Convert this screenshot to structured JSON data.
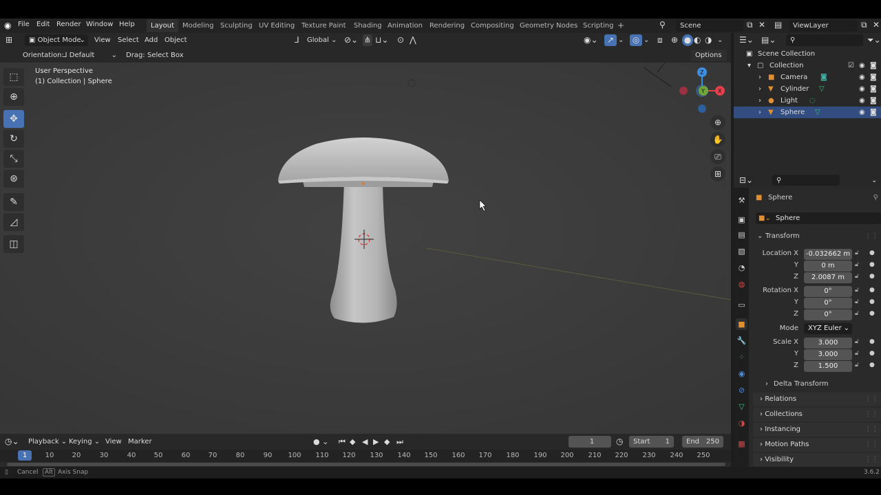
{
  "app": {
    "version": "3.6.2"
  },
  "topbar": {
    "menus": [
      "File",
      "Edit",
      "Render",
      "Window",
      "Help"
    ],
    "workspaces": [
      "Layout",
      "Modeling",
      "Sculpting",
      "UV Editing",
      "Texture Paint",
      "Shading",
      "Animation",
      "Rendering",
      "Compositing",
      "Geometry Nodes",
      "Scripting"
    ],
    "add_tab": "+",
    "scene": "Scene",
    "view_layer": "ViewLayer"
  },
  "viewport_header": {
    "mode": "Object Mode",
    "menus": [
      "View",
      "Select",
      "Add",
      "Object"
    ],
    "transform_orientation": "Global",
    "orientation_label": "Orientation:",
    "orientation_value": "Default",
    "drag_label": "Drag:",
    "drag_value": "Select Box",
    "options": "Options"
  },
  "viewport": {
    "perspective": "User Perspective",
    "collection_info": "(1) Collection | Sphere",
    "gizmo": {
      "x_color": "#e4404c",
      "y_color": "#6fa53a",
      "z_color": "#3f8ee0"
    }
  },
  "outliner": {
    "title": "Scene Collection",
    "collection": "Collection",
    "items": [
      "Camera",
      "Cylinder",
      "Light",
      "Sphere"
    ]
  },
  "properties": {
    "object_name": "Sphere",
    "data_name": "Sphere",
    "transform": {
      "title": "Transform",
      "location_label": "Location X",
      "location": [
        "-0.032662 m",
        "0 m",
        "2.0087 m"
      ],
      "rotation_label": "Rotation X",
      "rotation": [
        "0°",
        "0°",
        "0°"
      ],
      "mode_label": "Mode",
      "mode": "XYZ Euler",
      "scale_label": "Scale X",
      "scale": [
        "3.000",
        "3.000",
        "1.500"
      ],
      "y": "Y",
      "z": "Z",
      "delta": "Delta Transform"
    },
    "panels": [
      "Relations",
      "Collections",
      "Instancing",
      "Motion Paths",
      "Visibility"
    ]
  },
  "timeline": {
    "menus": [
      "Playback",
      "Keying",
      "View",
      "Marker"
    ],
    "current_frame": "1",
    "start_label": "Start",
    "start": "1",
    "end_label": "End",
    "end": "250",
    "ruler": [
      "1",
      "10",
      "20",
      "30",
      "40",
      "50",
      "60",
      "70",
      "80",
      "90",
      "100",
      "110",
      "120",
      "130",
      "140",
      "150",
      "160",
      "170",
      "180",
      "190",
      "200",
      "210",
      "220",
      "230",
      "240",
      "250"
    ]
  },
  "statusbar": {
    "cancel": "Cancel",
    "alt": "Alt",
    "axis_snap": "Axis Snap"
  },
  "colors": {
    "accent": "#4772b3",
    "selected": "#334d80",
    "viewport_bg": "#3c3c3c"
  }
}
